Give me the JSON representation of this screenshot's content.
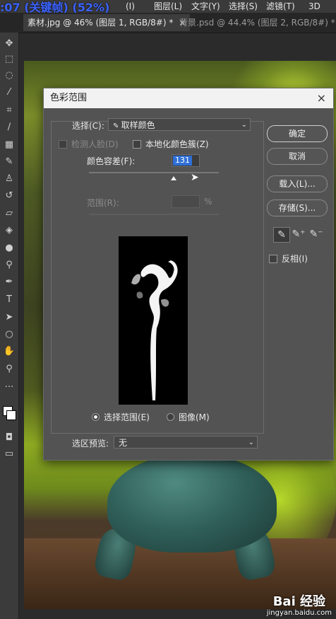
{
  "overlay_title": ":07 (关键帧) (52%)",
  "menu": [
    "(I)",
    "图层(L)",
    "文字(Y)",
    "选择(S)",
    "滤镜(T)",
    "3D"
  ],
  "tabs": [
    {
      "label": "素材.jpg @ 46% (图层 1, RGB/8#) *",
      "close": "×"
    },
    {
      "label": "背景.psd @ 44.4% (图层 2, RGB/8#) *",
      "close": "×"
    }
  ],
  "tools": [
    "move-icon",
    "marquee-icon",
    "lasso-icon",
    "magic-wand-icon",
    "crop-icon",
    "eyedropper-icon",
    "healing-icon",
    "brush-icon",
    "stamp-icon",
    "history-brush-icon",
    "eraser-icon",
    "paint-bucket-icon",
    "blur-icon",
    "dodge-icon",
    "pen-icon",
    "type-icon",
    "path-select-icon",
    "ellipse-icon",
    "hand-icon",
    "zoom-icon",
    "more-icon"
  ],
  "dialog": {
    "title": "色彩范围",
    "close": "×",
    "select_label": "选择(C):",
    "select_value": "取样颜色",
    "detect_faces": "检测人脸(D)",
    "localized": "本地化颜色簇(Z)",
    "fuzziness_label": "颜色容差(F):",
    "fuzziness_value": "131",
    "range_label": "范围(R):",
    "range_unit": "%",
    "radio_selection": "选择范围(E)",
    "radio_image": "图像(M)",
    "preview_label": "选区预览:",
    "preview_value": "无",
    "buttons": {
      "ok": "确定",
      "cancel": "取消",
      "load": "载入(L)...",
      "save": "存储(S)..."
    },
    "invert": "反相(I)"
  },
  "watermark": {
    "logo": "Bai 经验",
    "url": "jingyan.baidu.com"
  }
}
